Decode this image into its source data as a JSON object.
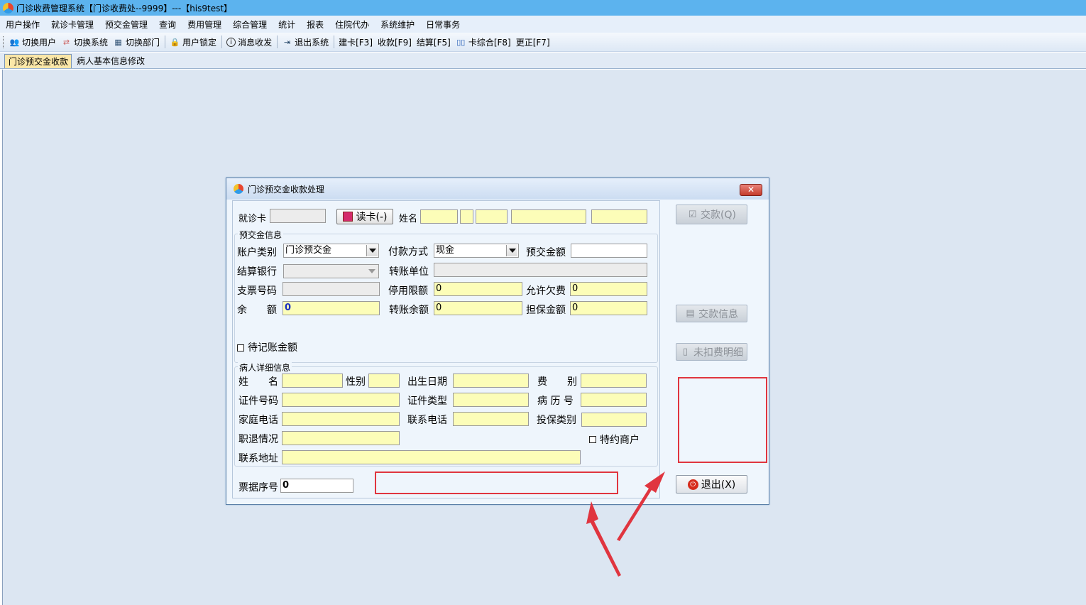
{
  "window": {
    "title": "门诊收费管理系统【门诊收费处--9999】---【his9test】"
  },
  "menu": [
    "用户操作",
    "就诊卡管理",
    "预交金管理",
    "查询",
    "费用管理",
    "综合管理",
    "统计",
    "报表",
    "住院代办",
    "系统维护",
    "日常事务"
  ],
  "toolbar": {
    "switch_user": "切换用户",
    "switch_system": "切换系统",
    "switch_dept": "切换部门",
    "lock_user": "用户锁定",
    "messages": "消息收发",
    "exit_system": "退出系统",
    "create_card": "建卡[F3]",
    "charge": "收款[F9]",
    "settle": "结算[F5]",
    "card_summary": "卡综合[F8]",
    "correct": "更正[F7]"
  },
  "tabs": [
    "门诊预交金收款",
    "病人基本信息修改"
  ],
  "dialog": {
    "title": "门诊预交金收款处理",
    "close": "✕",
    "card_label": "就诊卡",
    "read_card": "读卡(-)",
    "name_label": "姓名",
    "prepay_group": "预交金信息",
    "account_type_label": "账户类别",
    "account_type_value": "门诊预交金",
    "pay_method_label": "付款方式",
    "pay_method_value": "现金",
    "prepay_amount_label": "预交金额",
    "bank_label": "结算银行",
    "transfer_unit_label": "转账单位",
    "cheque_label": "支票号码",
    "stop_limit_label": "停用限额",
    "stop_limit_value": "0",
    "allow_debt_label": "允许欠费",
    "allow_debt_value": "0",
    "balance_label": "余　　额",
    "balance_value": "0",
    "transfer_balance_label": "转账余额",
    "transfer_balance_value": "0",
    "guarantee_label": "担保金额",
    "guarantee_value": "0",
    "pending_label": "待记账金额",
    "patient_group": "病人详细信息",
    "pname_label": "姓　　名",
    "sex_label": "性别",
    "birth_label": "出生日期",
    "fee_type_label": "费　　别",
    "id_no_label": "证件号码",
    "id_type_label": "证件类型",
    "record_no_label": "病 历 号",
    "home_phone_label": "家庭电话",
    "contact_phone_label": "联系电话",
    "insure_type_label": "投保类别",
    "retire_label": "职退情况",
    "special_label": "特约商户",
    "address_label": "联系地址",
    "receipt_label": "票据序号",
    "receipt_value": "0",
    "btn_pay": "交款(Q)",
    "btn_pay_info": "交款信息",
    "btn_undeducted": "未扣费明细",
    "btn_exit": "退出(X)"
  }
}
